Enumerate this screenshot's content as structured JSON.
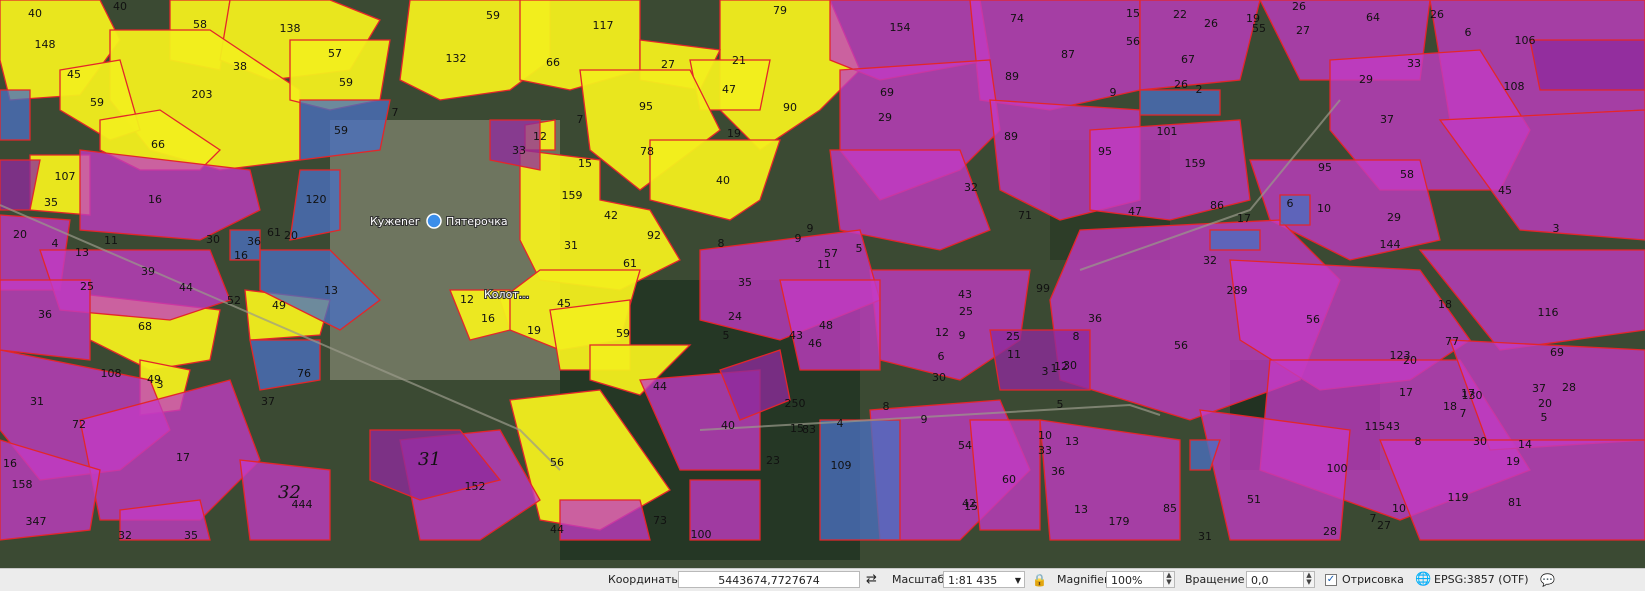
{
  "map": {
    "poi": {
      "village": "Кужener",
      "shop": "Пятерочка",
      "settlement": "Колот..."
    },
    "colors": {
      "yellow": "#f2ee1d",
      "magenta": "#c33bc4",
      "purple": "#8e2a9c",
      "blue": "#4a6fc0",
      "edge": "#e3262a"
    },
    "field_labels": [
      "148",
      "58",
      "138",
      "40",
      "59",
      "117",
      "79",
      "154",
      "74",
      "87",
      "56",
      "15",
      "22",
      "26",
      "19",
      "26",
      "64",
      "26",
      "106",
      "6",
      "45",
      "38",
      "57",
      "132",
      "66",
      "27",
      "21",
      "89",
      "67",
      "55",
      "27",
      "33",
      "59",
      "203",
      "59",
      "47",
      "90",
      "95",
      "69",
      "9",
      "26",
      "2",
      "29",
      "108",
      "7",
      "59",
      "12",
      "7",
      "33",
      "15",
      "78",
      "19",
      "29",
      "37",
      "101",
      "66",
      "95",
      "89",
      "159",
      "95",
      "58",
      "40",
      "107",
      "35",
      "16",
      "159",
      "42",
      "32",
      "71",
      "47",
      "86",
      "17",
      "6",
      "10",
      "29",
      "45",
      "120",
      "40",
      "92",
      "31",
      "61",
      "20",
      "16",
      "30",
      "20",
      "61",
      "11",
      "39",
      "13",
      "4",
      "25",
      "44",
      "36",
      "9",
      "8",
      "9",
      "11",
      "57",
      "5",
      "35",
      "46",
      "43",
      "99",
      "8",
      "56",
      "123",
      "116",
      "144",
      "36",
      "52",
      "13",
      "68",
      "49",
      "12",
      "16",
      "45",
      "19",
      "59",
      "44",
      "24",
      "5",
      "48",
      "43",
      "12",
      "9",
      "25",
      "11",
      "6",
      "30",
      "25",
      "36",
      "56",
      "289",
      "77",
      "17",
      "20",
      "18",
      "108",
      "49",
      "31",
      "72",
      "76",
      "37",
      "17",
      "250",
      "40",
      "83",
      "23",
      "4",
      "109",
      "54",
      "60",
      "15",
      "42",
      "33",
      "10",
      "36",
      "13",
      "13",
      "179",
      "85",
      "100",
      "27",
      "7",
      "130",
      "115",
      "14",
      "19",
      "119",
      "81",
      "10",
      "28",
      "16",
      "158",
      "347",
      "444",
      "152",
      "56",
      "44",
      "73",
      "100",
      "51",
      "31",
      "32",
      "35",
      "3",
      "3",
      "3",
      "1",
      "12",
      "30",
      "15",
      "8",
      "9",
      "5",
      "32",
      "69",
      "17",
      "7",
      "30",
      "43",
      "8",
      "5",
      "37",
      "20",
      "28",
      "18",
      "6"
    ],
    "handwritten": [
      "31",
      "32"
    ]
  },
  "statusbar": {
    "coord_label": "Координаты",
    "coord_value": "5443674,7727674",
    "scale_label": "Масштаб",
    "scale_value": "1:81 435",
    "magnifier_label": "Magnifier",
    "magnifier_value": "100%",
    "rotation_label": "Вращение",
    "rotation_value": "0,0",
    "render_label": "Отрисовка",
    "crs_label": "EPSG:3857 (OTF)"
  }
}
